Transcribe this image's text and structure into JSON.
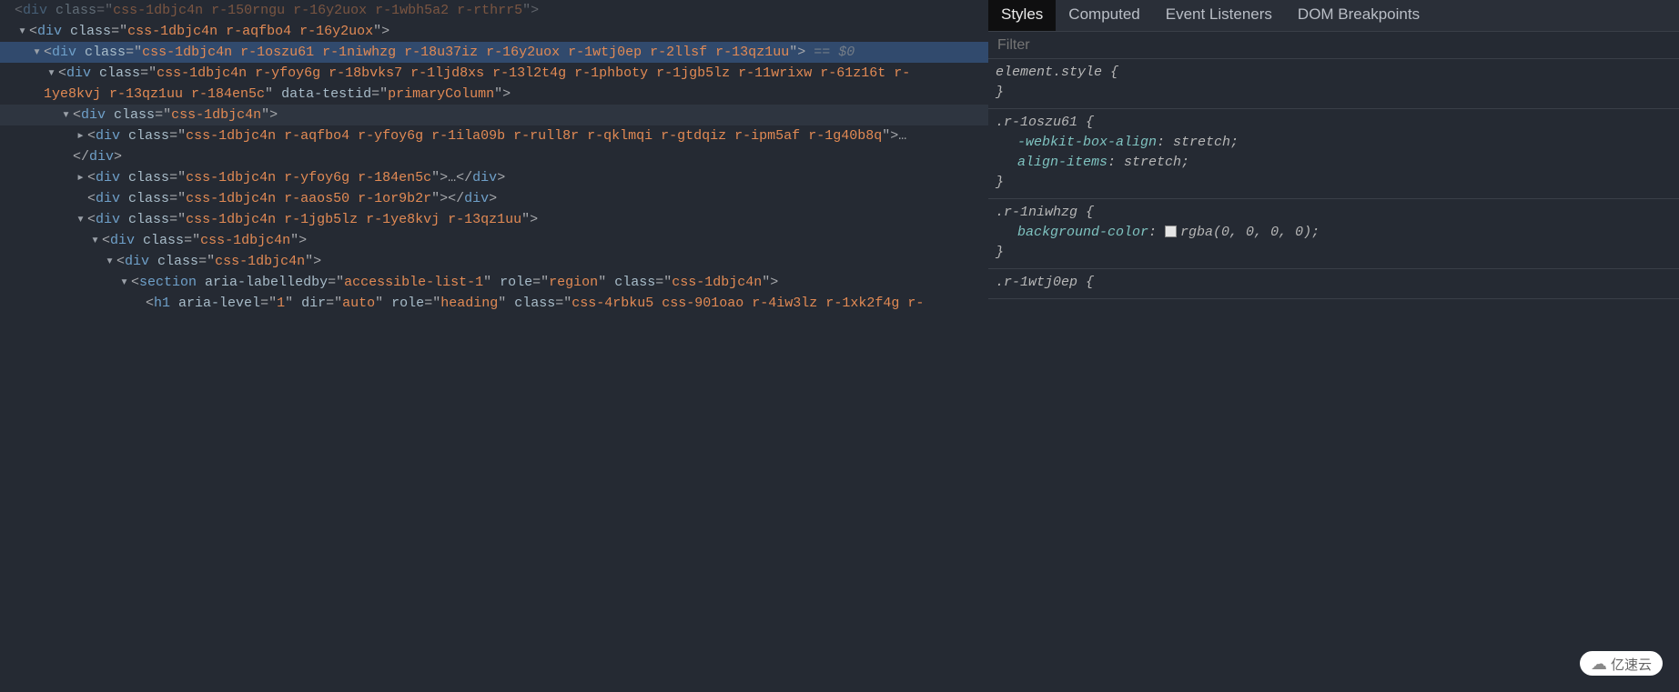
{
  "elements": {
    "lines": [
      {
        "indentKey": "ind0",
        "faded": true,
        "arrowKey": "none",
        "parts": [
          {
            "t": "punct",
            "v": "<"
          },
          {
            "t": "tag",
            "v": "div"
          },
          {
            "t": "punct",
            "v": " "
          },
          {
            "t": "attr",
            "v": "class"
          },
          {
            "t": "punct",
            "v": "=\""
          },
          {
            "t": "val",
            "v": "css-1dbjc4n r-150rngu r-16y2uox r-1wbh5a2 r-rthrr5"
          },
          {
            "t": "punct",
            "v": "\">"
          }
        ]
      },
      {
        "indentKey": "ind1",
        "arrowKey": "open",
        "parts": [
          {
            "t": "punct",
            "v": "<"
          },
          {
            "t": "tag",
            "v": "div"
          },
          {
            "t": "punct",
            "v": " "
          },
          {
            "t": "attr",
            "v": "class"
          },
          {
            "t": "punct",
            "v": "=\""
          },
          {
            "t": "val",
            "v": "css-1dbjc4n r-aqfbo4 r-16y2uox"
          },
          {
            "t": "punct",
            "v": "\">"
          }
        ]
      },
      {
        "indentKey": "ind2",
        "selected": true,
        "arrowKey": "open",
        "parts": [
          {
            "t": "punct",
            "v": "<"
          },
          {
            "t": "tag",
            "v": "div"
          },
          {
            "t": "punct",
            "v": " "
          },
          {
            "t": "attr",
            "v": "class"
          },
          {
            "t": "punct",
            "v": "=\""
          },
          {
            "t": "val",
            "v": "css-1dbjc4n r-1oszu61 r-1niwhzg r-18u37iz r-16y2uox r-1wtj0ep r-2llsf r-13qz1uu"
          },
          {
            "t": "punct",
            "v": "\"> "
          },
          {
            "t": "halo",
            "v": "== $0"
          }
        ]
      },
      {
        "indentKey": "ind3",
        "arrowKey": "open",
        "parts": [
          {
            "t": "punct",
            "v": "<"
          },
          {
            "t": "tag",
            "v": "div"
          },
          {
            "t": "punct",
            "v": " "
          },
          {
            "t": "attr",
            "v": "class"
          },
          {
            "t": "punct",
            "v": "=\""
          },
          {
            "t": "val",
            "v": "css-1dbjc4n r-yfoy6g r-18bvks7 r-1ljd8xs r-13l2t4g r-1phboty r-1jgb5lz r-11wrixw r-61z16t r-"
          },
          {
            "t": "punct",
            "v": ""
          }
        ]
      },
      {
        "indentKey": "ind3-wrap",
        "arrowKey": "none",
        "parts": [
          {
            "t": "val",
            "v": "1ye8kvj r-13qz1uu r-184en5c"
          },
          {
            "t": "punct",
            "v": "\" "
          },
          {
            "t": "attr",
            "v": "data-testid"
          },
          {
            "t": "punct",
            "v": "=\""
          },
          {
            "t": "val",
            "v": "primaryColumn"
          },
          {
            "t": "punct",
            "v": "\">"
          }
        ]
      },
      {
        "indentKey": "ind4",
        "hover": true,
        "arrowKey": "open",
        "parts": [
          {
            "t": "punct",
            "v": "<"
          },
          {
            "t": "tag",
            "v": "div"
          },
          {
            "t": "punct",
            "v": " "
          },
          {
            "t": "attr",
            "v": "class"
          },
          {
            "t": "punct",
            "v": "=\""
          },
          {
            "t": "val",
            "v": "css-1dbjc4n"
          },
          {
            "t": "punct",
            "v": "\">"
          }
        ]
      },
      {
        "indentKey": "ind5",
        "arrowKey": "closed",
        "parts": [
          {
            "t": "punct",
            "v": "<"
          },
          {
            "t": "tag",
            "v": "div"
          },
          {
            "t": "punct",
            "v": " "
          },
          {
            "t": "attr",
            "v": "class"
          },
          {
            "t": "punct",
            "v": "=\""
          },
          {
            "t": "val",
            "v": "css-1dbjc4n r-aqfbo4 r-yfoy6g r-1ila09b r-rull8r r-qklmqi r-gtdqiz r-ipm5af r-1g40b8q"
          },
          {
            "t": "punct",
            "v": "\">"
          },
          {
            "t": "ell",
            "v": "…"
          }
        ]
      },
      {
        "indentKey": "ind4c",
        "arrowKey": "none",
        "parts": [
          {
            "t": "punct",
            "v": "</"
          },
          {
            "t": "tag",
            "v": "div"
          },
          {
            "t": "punct",
            "v": ">"
          }
        ]
      },
      {
        "indentKey": "ind5",
        "arrowKey": "closed",
        "parts": [
          {
            "t": "punct",
            "v": "<"
          },
          {
            "t": "tag",
            "v": "div"
          },
          {
            "t": "punct",
            "v": " "
          },
          {
            "t": "attr",
            "v": "class"
          },
          {
            "t": "punct",
            "v": "=\""
          },
          {
            "t": "val",
            "v": "css-1dbjc4n r-yfoy6g r-184en5c"
          },
          {
            "t": "punct",
            "v": "\">"
          },
          {
            "t": "ell",
            "v": "…"
          },
          {
            "t": "punct",
            "v": "</"
          },
          {
            "t": "tag",
            "v": "div"
          },
          {
            "t": "punct",
            "v": ">"
          }
        ]
      },
      {
        "indentKey": "ind5",
        "arrowKey": "none",
        "parts": [
          {
            "t": "punct",
            "v": "<"
          },
          {
            "t": "tag",
            "v": "div"
          },
          {
            "t": "punct",
            "v": " "
          },
          {
            "t": "attr",
            "v": "class"
          },
          {
            "t": "punct",
            "v": "=\""
          },
          {
            "t": "val",
            "v": "css-1dbjc4n r-aaos50 r-1or9b2r"
          },
          {
            "t": "punct",
            "v": "\"></"
          },
          {
            "t": "tag",
            "v": "div"
          },
          {
            "t": "punct",
            "v": ">"
          }
        ]
      },
      {
        "indentKey": "ind5",
        "arrowKey": "open",
        "parts": [
          {
            "t": "punct",
            "v": "<"
          },
          {
            "t": "tag",
            "v": "div"
          },
          {
            "t": "punct",
            "v": " "
          },
          {
            "t": "attr",
            "v": "class"
          },
          {
            "t": "punct",
            "v": "=\""
          },
          {
            "t": "val",
            "v": "css-1dbjc4n r-1jgb5lz r-1ye8kvj r-13qz1uu"
          },
          {
            "t": "punct",
            "v": "\">"
          }
        ]
      },
      {
        "indentKey": "ind6",
        "arrowKey": "open",
        "parts": [
          {
            "t": "punct",
            "v": "<"
          },
          {
            "t": "tag",
            "v": "div"
          },
          {
            "t": "punct",
            "v": " "
          },
          {
            "t": "attr",
            "v": "class"
          },
          {
            "t": "punct",
            "v": "=\""
          },
          {
            "t": "val",
            "v": "css-1dbjc4n"
          },
          {
            "t": "punct",
            "v": "\">"
          }
        ]
      },
      {
        "indentKey": "ind7",
        "arrowKey": "open",
        "parts": [
          {
            "t": "punct",
            "v": "<"
          },
          {
            "t": "tag",
            "v": "div"
          },
          {
            "t": "punct",
            "v": " "
          },
          {
            "t": "attr",
            "v": "class"
          },
          {
            "t": "punct",
            "v": "=\""
          },
          {
            "t": "val",
            "v": "css-1dbjc4n"
          },
          {
            "t": "punct",
            "v": "\">"
          }
        ]
      },
      {
        "indentKey": "ind8",
        "arrowKey": "open",
        "parts": [
          {
            "t": "punct",
            "v": "<"
          },
          {
            "t": "tag",
            "v": "section"
          },
          {
            "t": "punct",
            "v": " "
          },
          {
            "t": "attr",
            "v": "aria-labelledby"
          },
          {
            "t": "punct",
            "v": "=\""
          },
          {
            "t": "val",
            "v": "accessible-list-1"
          },
          {
            "t": "punct",
            "v": "\" "
          },
          {
            "t": "attr",
            "v": "role"
          },
          {
            "t": "punct",
            "v": "=\""
          },
          {
            "t": "val",
            "v": "region"
          },
          {
            "t": "punct",
            "v": "\" "
          },
          {
            "t": "attr",
            "v": "class"
          },
          {
            "t": "punct",
            "v": "=\""
          },
          {
            "t": "val",
            "v": "css-1dbjc4n"
          },
          {
            "t": "punct",
            "v": "\">"
          }
        ]
      },
      {
        "indentKey": "ind9",
        "arrowKey": "none",
        "parts": [
          {
            "t": "punct",
            "v": "<"
          },
          {
            "t": "tag",
            "v": "h1"
          },
          {
            "t": "punct",
            "v": " "
          },
          {
            "t": "attr",
            "v": "aria-level"
          },
          {
            "t": "punct",
            "v": "=\""
          },
          {
            "t": "val",
            "v": "1"
          },
          {
            "t": "punct",
            "v": "\" "
          },
          {
            "t": "attr",
            "v": "dir"
          },
          {
            "t": "punct",
            "v": "=\""
          },
          {
            "t": "val",
            "v": "auto"
          },
          {
            "t": "punct",
            "v": "\" "
          },
          {
            "t": "attr",
            "v": "role"
          },
          {
            "t": "punct",
            "v": "=\""
          },
          {
            "t": "val",
            "v": "heading"
          },
          {
            "t": "punct",
            "v": "\" "
          },
          {
            "t": "attr",
            "v": "class"
          },
          {
            "t": "punct",
            "v": "=\""
          },
          {
            "t": "val",
            "v": "css-4rbku5 css-901oao r-4iw3lz r-1xk2f4g r-"
          },
          {
            "t": "punct",
            "v": ""
          }
        ]
      }
    ]
  },
  "tabs": {
    "items": [
      "Styles",
      "Computed",
      "Event Listeners",
      "DOM Breakpoints"
    ],
    "activeIndex": 0
  },
  "filter": {
    "placeholder": "Filter"
  },
  "rules": [
    {
      "selector": "element.style",
      "open": "{",
      "declarations": [],
      "close": "}"
    },
    {
      "selector": ".r-1oszu61",
      "open": "{",
      "declarations": [
        {
          "prop": "-webkit-box-align",
          "val": "stretch"
        },
        {
          "prop": "align-items",
          "val": "stretch"
        }
      ],
      "close": "}"
    },
    {
      "selector": ".r-1niwhzg",
      "open": "{",
      "declarations": [
        {
          "prop": "background-color",
          "val": "rgba(0, 0, 0, 0)",
          "swatch": true
        }
      ],
      "close": "}"
    },
    {
      "selector": ".r-1wtj0ep",
      "open": "{",
      "declarations": [],
      "close": ""
    }
  ],
  "watermark": {
    "text": "亿速云"
  }
}
